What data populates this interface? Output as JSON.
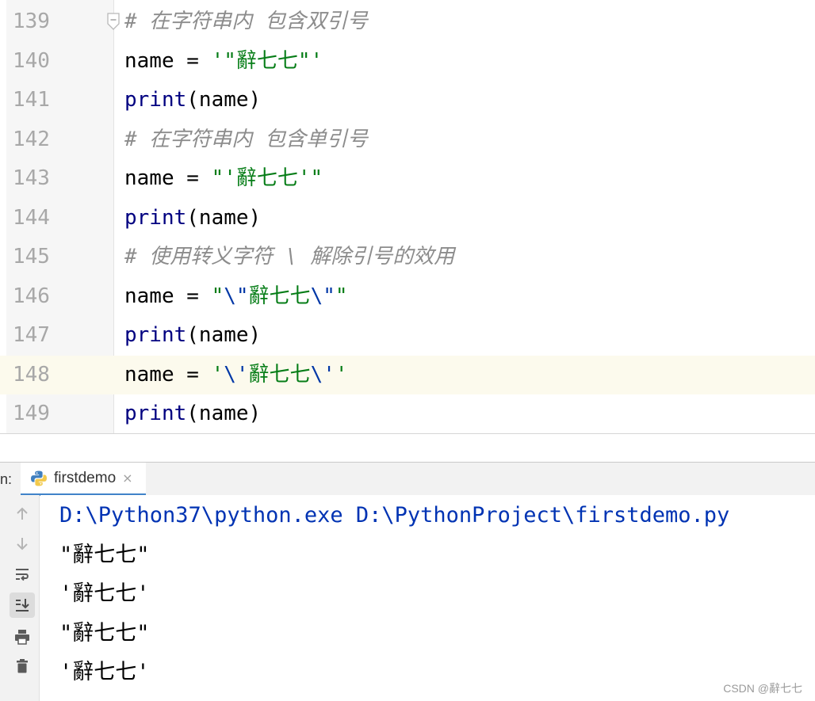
{
  "editor": {
    "current_line": "148",
    "lines": [
      {
        "num": "139",
        "parts": [
          {
            "t": "# 在字符串内 包含双引号",
            "c": "comment"
          }
        ]
      },
      {
        "num": "140",
        "parts": [
          {
            "t": "name = ",
            "c": "plain"
          },
          {
            "t": "'\"辭七七\"'",
            "c": "str"
          }
        ]
      },
      {
        "num": "141",
        "parts": [
          {
            "t": "print",
            "c": "kw-fn"
          },
          {
            "t": "(name)",
            "c": "plain"
          }
        ]
      },
      {
        "num": "142",
        "parts": [
          {
            "t": "# 在字符串内 包含单引号",
            "c": "comment"
          }
        ]
      },
      {
        "num": "143",
        "parts": [
          {
            "t": "name = ",
            "c": "plain"
          },
          {
            "t": "\"'辭七七'\"",
            "c": "str"
          }
        ]
      },
      {
        "num": "144",
        "parts": [
          {
            "t": "print",
            "c": "kw-fn"
          },
          {
            "t": "(name)",
            "c": "plain"
          }
        ]
      },
      {
        "num": "145",
        "parts": [
          {
            "t": "# 使用转义字符 \\ 解除引号的效用",
            "c": "comment"
          }
        ]
      },
      {
        "num": "146",
        "parts": [
          {
            "t": "name = ",
            "c": "plain"
          },
          {
            "t": "\"",
            "c": "str"
          },
          {
            "t": "\\\"",
            "c": "esc"
          },
          {
            "t": "辭七七",
            "c": "str"
          },
          {
            "t": "\\\"",
            "c": "esc"
          },
          {
            "t": "\"",
            "c": "str"
          }
        ]
      },
      {
        "num": "147",
        "parts": [
          {
            "t": "print",
            "c": "kw-fn"
          },
          {
            "t": "(name)",
            "c": "plain"
          }
        ]
      },
      {
        "num": "148",
        "parts": [
          {
            "t": "name = ",
            "c": "plain"
          },
          {
            "t": "'",
            "c": "str"
          },
          {
            "t": "\\'",
            "c": "esc"
          },
          {
            "t": "辭七七",
            "c": "str"
          },
          {
            "t": "\\'",
            "c": "esc"
          },
          {
            "t": "'",
            "c": "str"
          }
        ]
      },
      {
        "num": "149",
        "parts": [
          {
            "t": "print",
            "c": "kw-fn"
          },
          {
            "t": "(name)",
            "c": "plain"
          }
        ]
      }
    ]
  },
  "run": {
    "label": "n:",
    "tab": {
      "title": "firstdemo",
      "close": "×",
      "icon": "python-icon"
    },
    "toolbar": [
      {
        "name": "scroll-up-icon",
        "active": false
      },
      {
        "name": "scroll-down-icon",
        "active": false
      },
      {
        "name": "soft-wrap-icon",
        "active": false
      },
      {
        "name": "scroll-to-end-icon",
        "active": true
      },
      {
        "name": "print-icon",
        "active": false
      },
      {
        "name": "trash-icon",
        "active": false
      }
    ],
    "console": [
      {
        "text": "D:\\Python37\\python.exe D:\\PythonProject\\firstdemo.py",
        "kind": "cmd"
      },
      {
        "text": "\"辭七七\"",
        "kind": "out"
      },
      {
        "text": "'辭七七'",
        "kind": "out"
      },
      {
        "text": "\"辭七七\"",
        "kind": "out"
      },
      {
        "text": "'辭七七'",
        "kind": "out"
      }
    ]
  },
  "watermark": "CSDN @辭七七",
  "colors": {
    "comment": "#8c8c8c",
    "keyword": "#000080",
    "string": "#067d17",
    "escape": "#0037a6",
    "current_line": "#fcfaed",
    "console_cmd": "#0033b3"
  }
}
